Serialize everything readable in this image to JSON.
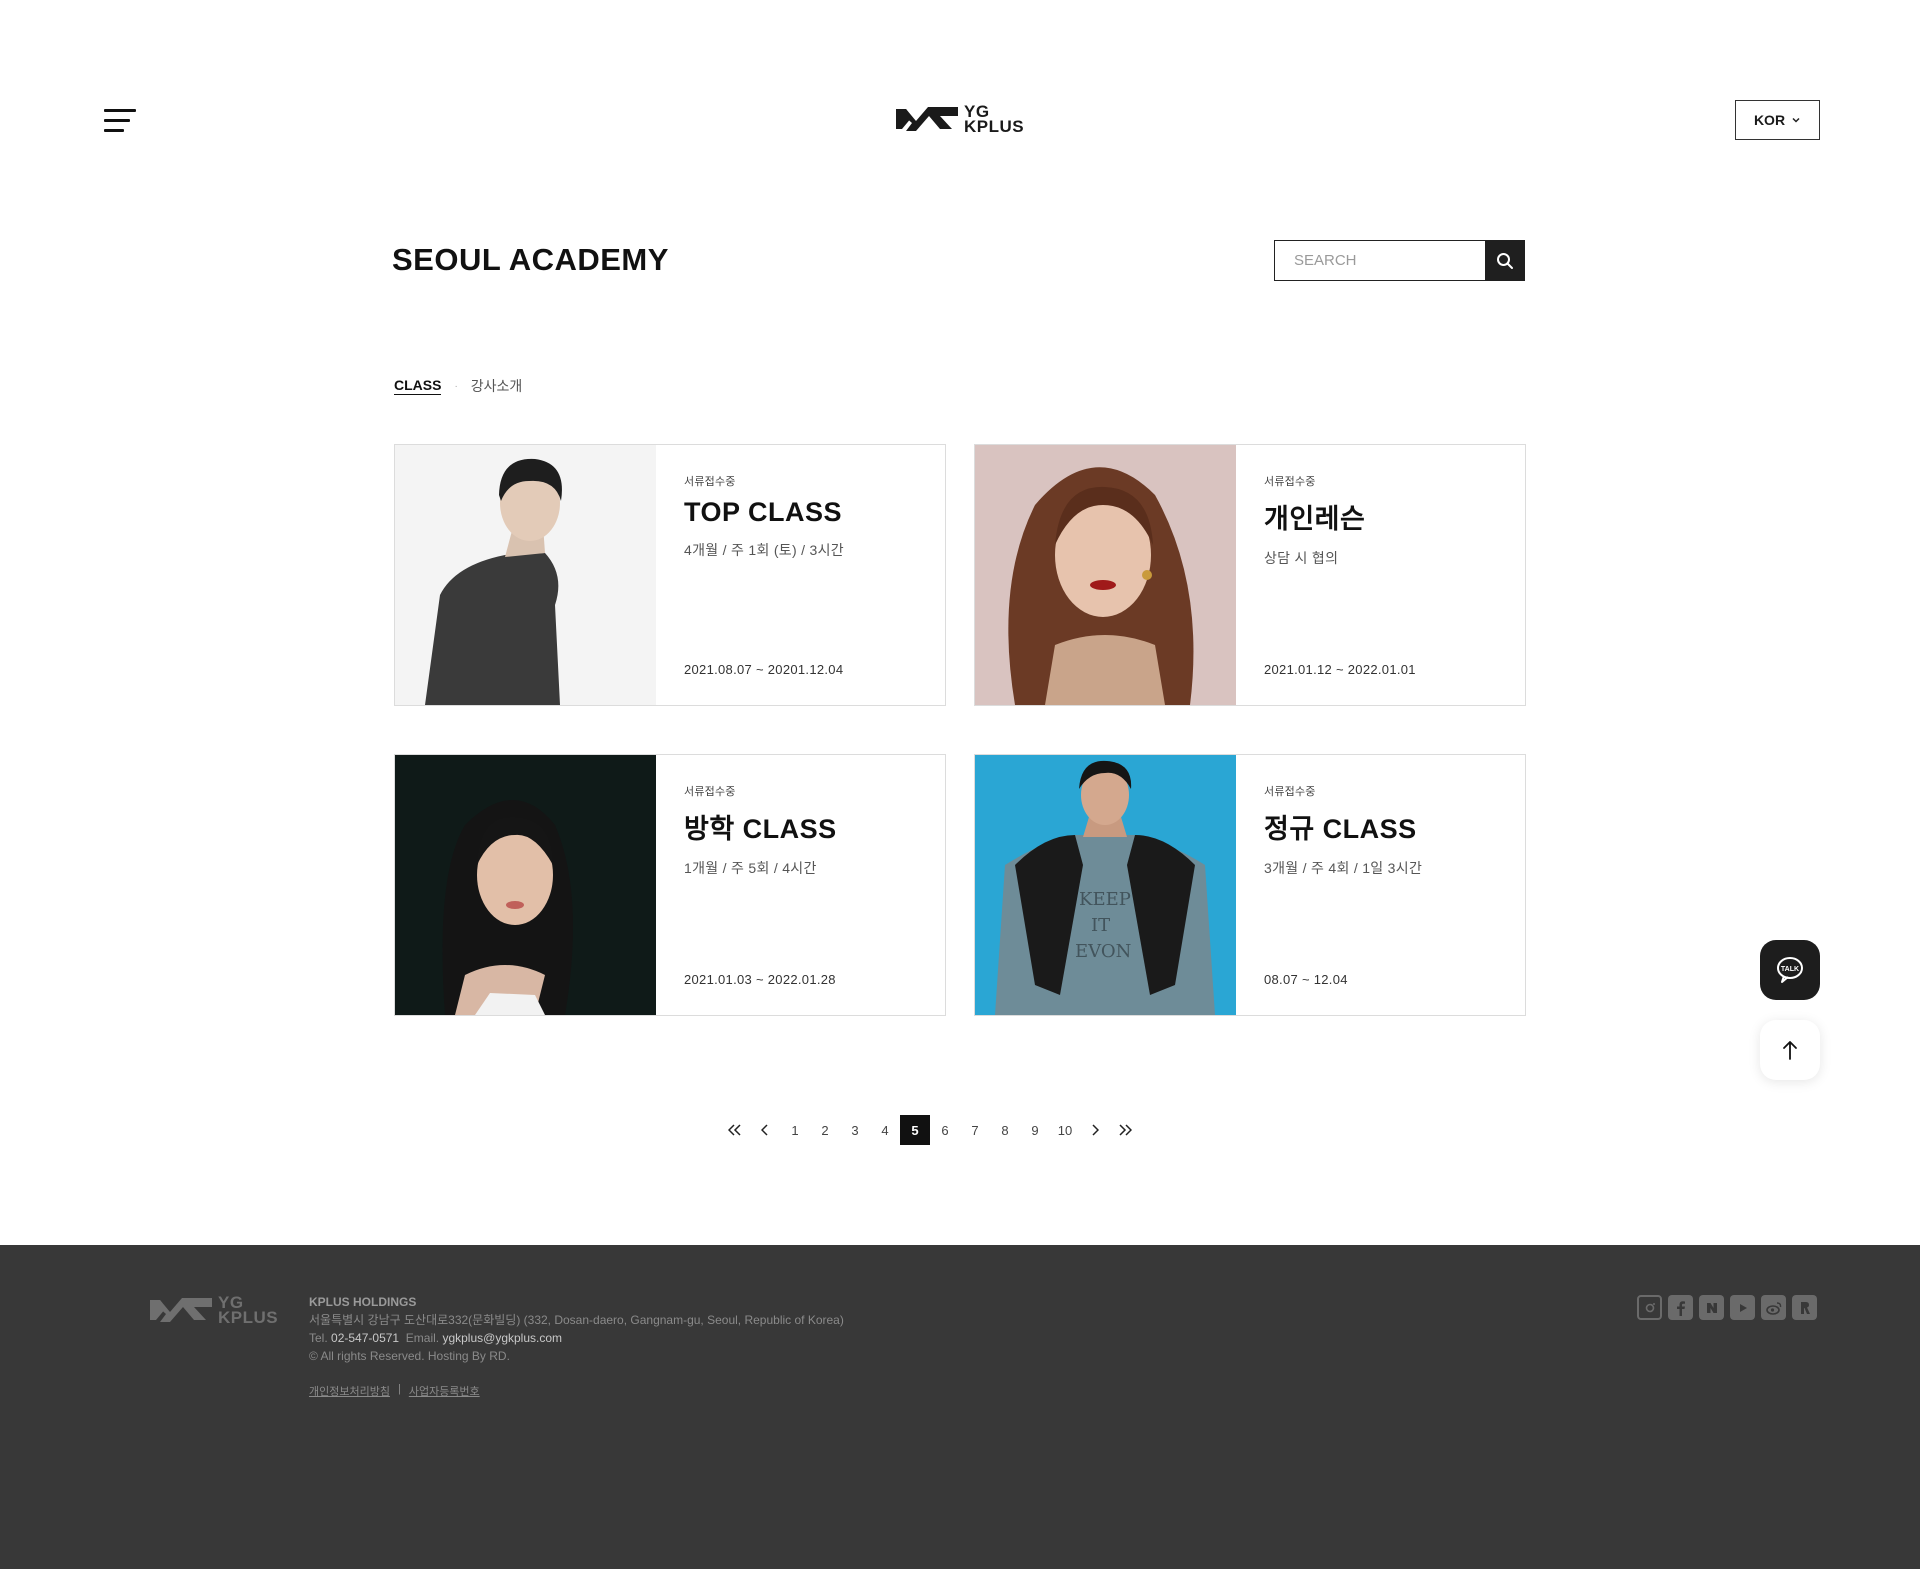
{
  "header": {
    "logo_line1": "YG",
    "logo_line2": "KPLUS",
    "lang_label": "KOR"
  },
  "page": {
    "title": "SEOUL ACADEMY",
    "search_placeholder": "SEARCH"
  },
  "subnav": {
    "active": "CLASS",
    "separator": "·",
    "other": "강사소개"
  },
  "cards": [
    {
      "status": "서류접수중",
      "name": "TOP CLASS",
      "desc": "4개월 / 주 1회 (토) / 3시간",
      "period": "2021.08.07 ~ 20201.12.04"
    },
    {
      "status": "서류접수중",
      "name": "개인레슨",
      "desc": "상담 시 협의",
      "period": "2021.01.12 ~ 2022.01.01"
    },
    {
      "status": "서류접수중",
      "name": "방학 CLASS",
      "desc": "1개월 / 주 5회 / 4시간",
      "period": "2021.01.03 ~ 2022.01.28"
    },
    {
      "status": "서류접수중",
      "name": "정규 CLASS",
      "desc": "3개월 / 주 4회 / 1일 3시간",
      "period": "08.07 ~ 12.04"
    }
  ],
  "pagination": {
    "pages": [
      "1",
      "2",
      "3",
      "4",
      "5",
      "6",
      "7",
      "8",
      "9",
      "10"
    ],
    "current": "5"
  },
  "floating": {
    "talk_label": "TALK"
  },
  "footer": {
    "logo_line1": "YG",
    "logo_line2": "KPLUS",
    "company": "KPLUS HOLDINGS",
    "address": "서울특별시 강남구 도산대로332(문화빌딩) (332, Dosan-daero, Gangnam-gu, Seoul, Republic of Korea)",
    "tel_label": "Tel.",
    "tel": "02-547-0571",
    "email_label": "Email.",
    "email": "ygkplus@ygkplus.com",
    "copyright": "© All rights Reserved. Hosting By RD.",
    "link_privacy": "개인정보처리방침",
    "link_sep": "|",
    "link_business": "사업자등록번호",
    "socials": [
      "instagram-icon",
      "facebook-icon",
      "naver-icon",
      "youtube-icon",
      "weibo-icon",
      "kakao-story-icon"
    ]
  },
  "colors": {
    "footer_bg": "#383838",
    "dark": "#1d1d1d",
    "border": "#dcdcdc"
  }
}
